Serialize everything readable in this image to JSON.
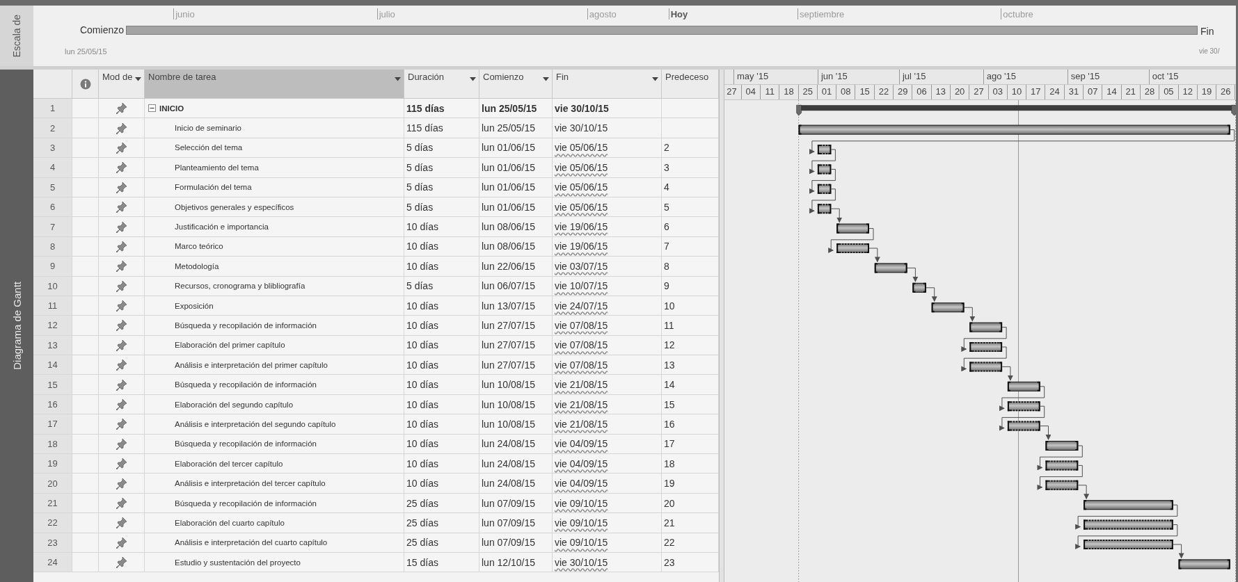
{
  "timeline": {
    "side_label": "Escala de",
    "start_label": "Comienzo",
    "start_date": "lun 25/05/15",
    "end_label": "Fin",
    "end_date": "vie 30/",
    "markers": [
      {
        "label": "junio",
        "kind": "month"
      },
      {
        "label": "julio",
        "kind": "month"
      },
      {
        "label": "agosto",
        "kind": "month"
      },
      {
        "label": "Hoy",
        "kind": "today"
      },
      {
        "label": "septiembre",
        "kind": "month"
      },
      {
        "label": "octubre",
        "kind": "month"
      }
    ]
  },
  "view_label": "Diagrama de Gantt",
  "table": {
    "columns": [
      {
        "kind": "id",
        "filter": false,
        "selected": false
      },
      {
        "kind": "info",
        "filter": false,
        "selected": false
      },
      {
        "kind": "mode",
        "label": "Mod de",
        "filter": true,
        "selected": false
      },
      {
        "kind": "name",
        "label": "Nombre de tarea",
        "filter": true,
        "selected": true
      },
      {
        "kind": "duration",
        "label": "Duración",
        "filter": true,
        "selected": false
      },
      {
        "kind": "start",
        "label": "Comienzo",
        "filter": true,
        "selected": false
      },
      {
        "kind": "finish",
        "label": "Fin",
        "filter": true,
        "selected": false
      },
      {
        "kind": "predecessors",
        "label": "Predeceso",
        "filter": false,
        "selected": false
      }
    ],
    "rows": [
      {
        "id": "1",
        "name": "INICIO",
        "duration": "115 días",
        "start": "lun 25/05/15",
        "finish": "vie 30/10/15",
        "finish_flagged": false,
        "expanded": true,
        "children": [
          {
            "id": "2",
            "name": "Inicio de seminario",
            "duration": "115 días",
            "start": "lun 25/05/15",
            "finish": "vie 30/10/15",
            "finish_flagged": false,
            "dotted": false
          },
          {
            "id": "3",
            "name": "Selección del tema",
            "duration": "5 días",
            "start": "lun 01/06/15",
            "finish": "vie 05/06/15",
            "predecessors": "2",
            "finish_flagged": true,
            "dotted": true
          },
          {
            "id": "4",
            "name": "Planteamiento del tema",
            "duration": "5 días",
            "start": "lun 01/06/15",
            "finish": "vie 05/06/15",
            "predecessors": "3",
            "finish_flagged": true,
            "dotted": true
          },
          {
            "id": "5",
            "name": "Formulación del tema",
            "duration": "5 días",
            "start": "lun 01/06/15",
            "finish": "vie 05/06/15",
            "predecessors": "4",
            "finish_flagged": true,
            "dotted": true
          },
          {
            "id": "6",
            "name": "Objetivos generales y específicos",
            "duration": "5 días",
            "start": "lun 01/06/15",
            "finish": "vie 05/06/15",
            "predecessors": "5",
            "finish_flagged": true,
            "dotted": true
          },
          {
            "id": "7",
            "name": "Justificación e importancia",
            "duration": "10 días",
            "start": "lun 08/06/15",
            "finish": "vie 19/06/15",
            "predecessors": "6",
            "finish_flagged": true,
            "dotted": false
          },
          {
            "id": "8",
            "name": "Marco teórico",
            "duration": "10 días",
            "start": "lun 08/06/15",
            "finish": "vie 19/06/15",
            "predecessors": "7",
            "finish_flagged": true,
            "dotted": true
          },
          {
            "id": "9",
            "name": "Metodología",
            "duration": "10 días",
            "start": "lun 22/06/15",
            "finish": "vie 03/07/15",
            "predecessors": "8",
            "finish_flagged": true,
            "dotted": false
          },
          {
            "id": "10",
            "name": "Recursos, cronograma y blibliografía",
            "duration": "5 días",
            "start": "lun 06/07/15",
            "finish": "vie 10/07/15",
            "predecessors": "9",
            "finish_flagged": true,
            "dotted": false
          },
          {
            "id": "11",
            "name": "Exposición",
            "duration": "10 días",
            "start": "lun 13/07/15",
            "finish": "vie 24/07/15",
            "predecessors": "10",
            "finish_flagged": true,
            "dotted": false
          },
          {
            "id": "12",
            "name": "Búsqueda y recopilación de información",
            "duration": "10 días",
            "start": "lun 27/07/15",
            "finish": "vie 07/08/15",
            "predecessors": "11",
            "finish_flagged": true,
            "dotted": false
          },
          {
            "id": "13",
            "name": "Elaboración del primer capítulo",
            "duration": "10 días",
            "start": "lun 27/07/15",
            "finish": "vie 07/08/15",
            "predecessors": "12",
            "finish_flagged": true,
            "dotted": true
          },
          {
            "id": "14",
            "name": "Análisis e interpretación del primer capítulo",
            "duration": "10 días",
            "start": "lun 27/07/15",
            "finish": "vie 07/08/15",
            "predecessors": "13",
            "finish_flagged": true,
            "dotted": true
          },
          {
            "id": "15",
            "name": "Búsqueda y recopilación de información",
            "duration": "10 días",
            "start": "lun 10/08/15",
            "finish": "vie 21/08/15",
            "predecessors": "14",
            "finish_flagged": true,
            "dotted": false
          },
          {
            "id": "16",
            "name": "Elaboración del segundo capítulo",
            "duration": "10 días",
            "start": "lun 10/08/15",
            "finish": "vie 21/08/15",
            "predecessors": "15",
            "finish_flagged": true,
            "dotted": true
          },
          {
            "id": "17",
            "name": "Análisis e interpretación del segundo capítulo",
            "duration": "10 días",
            "start": "lun 10/08/15",
            "finish": "vie 21/08/15",
            "predecessors": "16",
            "finish_flagged": true,
            "dotted": true
          },
          {
            "id": "18",
            "name": "Búsqueda y recopilación de información",
            "duration": "10 días",
            "start": "lun 24/08/15",
            "finish": "vie 04/09/15",
            "predecessors": "17",
            "finish_flagged": true,
            "dotted": false
          },
          {
            "id": "19",
            "name": "Elaboración del tercer capítulo",
            "duration": "10 días",
            "start": "lun 24/08/15",
            "finish": "vie 04/09/15",
            "predecessors": "18",
            "finish_flagged": true,
            "dotted": true
          },
          {
            "id": "20",
            "name": "Análisis e interpretación del tercer capítulo",
            "duration": "10 días",
            "start": "lun 24/08/15",
            "finish": "vie 04/09/15",
            "predecessors": "19",
            "finish_flagged": true,
            "dotted": true
          },
          {
            "id": "21",
            "name": "Búsqueda y recopilación de información",
            "duration": "25 días",
            "start": "lun 07/09/15",
            "finish": "vie 09/10/15",
            "predecessors": "20",
            "finish_flagged": true,
            "dotted": false
          },
          {
            "id": "22",
            "name": "Elaboración del cuarto capítulo",
            "duration": "25 días",
            "start": "lun 07/09/15",
            "finish": "vie 09/10/15",
            "predecessors": "21",
            "finish_flagged": true,
            "dotted": true
          },
          {
            "id": "23",
            "name": "Análisis e interpretación del cuarto capítulo",
            "duration": "25 días",
            "start": "lun 07/09/15",
            "finish": "vie 09/10/15",
            "predecessors": "22",
            "finish_flagged": true,
            "dotted": true
          },
          {
            "id": "24",
            "name": "Estudio y sustentación del proyecto",
            "duration": "15 días",
            "start": "lun 12/10/15",
            "finish": "vie 30/10/15",
            "predecessors": "23",
            "finish_flagged": true,
            "dotted": false
          }
        ]
      }
    ]
  },
  "gantt": {
    "months": [
      "may '15",
      "jun '15",
      "jul '15",
      "ago '15",
      "sep '15",
      "oct '15"
    ],
    "weeks": [
      "27",
      "04",
      "11",
      "18",
      "25",
      "01",
      "08",
      "15",
      "22",
      "29",
      "06",
      "13",
      "20",
      "27",
      "03",
      "10",
      "17",
      "24",
      "31",
      "07",
      "14",
      "21",
      "28",
      "05",
      "12",
      "19",
      "26"
    ]
  }
}
